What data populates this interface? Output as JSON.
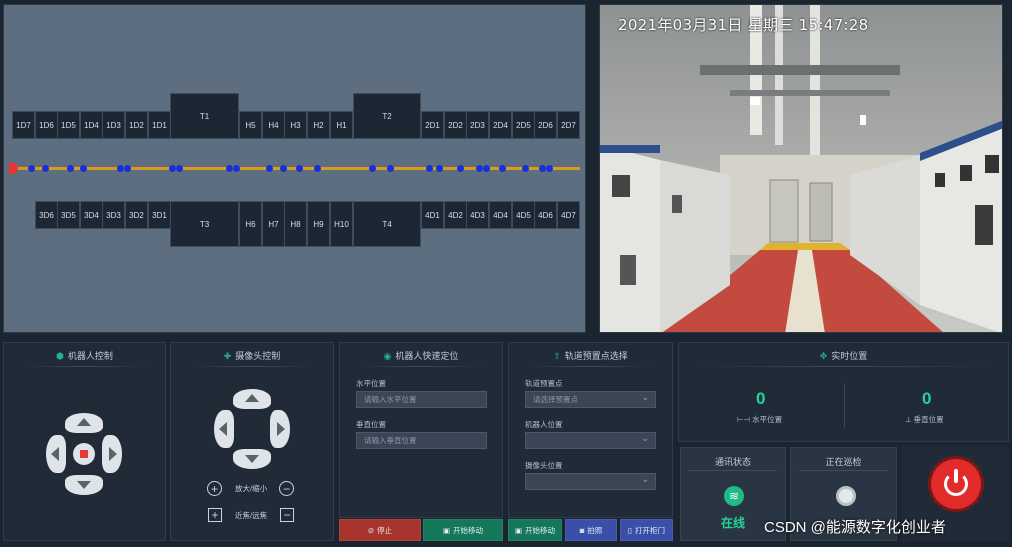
{
  "map": {
    "top_cabinets": [
      "1D7",
      "1D6",
      "1D5",
      "1D4",
      "1D3",
      "1D2",
      "1D1",
      "T1",
      "H5",
      "H4",
      "H3",
      "H2",
      "H1",
      "T2",
      "2D1",
      "2D2",
      "2D3",
      "2D4",
      "2D5",
      "2D6",
      "2D7"
    ],
    "bottom_cabinets": [
      "3D6",
      "3D5",
      "3D4",
      "3D3",
      "3D2",
      "3D1",
      "T3",
      "H6",
      "H7",
      "H8",
      "H9",
      "H10",
      "T4",
      "4D1",
      "4D2",
      "4D3",
      "4D4",
      "4D5",
      "4D6",
      "4D7"
    ],
    "rail_color": "#d99b1c",
    "waypoint_color": "#1530d8",
    "robot_color": "#e33333"
  },
  "camera": {
    "timestamp": "2021年03月31日  星期三  15:47:28"
  },
  "robot_control": {
    "title": "机器人控制",
    "center_color": "#e53935"
  },
  "camera_control": {
    "title": "摄像头控制",
    "zoom_label": "放大/缩小",
    "focus_label": "近焦/远焦",
    "plus": "+",
    "minus": "−"
  },
  "quick_position": {
    "title": "机器人快速定位",
    "h_label": "水平位置",
    "h_placeholder": "请输入水平位置",
    "v_label": "垂直位置",
    "v_placeholder": "请输入垂直位置"
  },
  "preset_select": {
    "title": "轨道预置点选择",
    "preset_label": "轨道预置点",
    "preset_value": "请选择预置点",
    "robot_pos_label": "机器人位置",
    "cam_pos_label": "摄像头位置"
  },
  "realtime": {
    "title": "实时位置",
    "h_value": "0",
    "h_label": "水平位置",
    "v_value": "0",
    "v_label": "垂直位置"
  },
  "comm": {
    "title": "通讯状态",
    "status": "在线"
  },
  "inspect": {
    "title": "正在巡检"
  },
  "power": {
    "color": "#e42b2b"
  },
  "buttons": {
    "stop": "停止",
    "start_move_1": "开始移动",
    "start_move_2": "开始移动",
    "photo": "拍照",
    "open_cabinet": "打开柜门"
  },
  "watermark": "CSDN @能源数字化创业者"
}
